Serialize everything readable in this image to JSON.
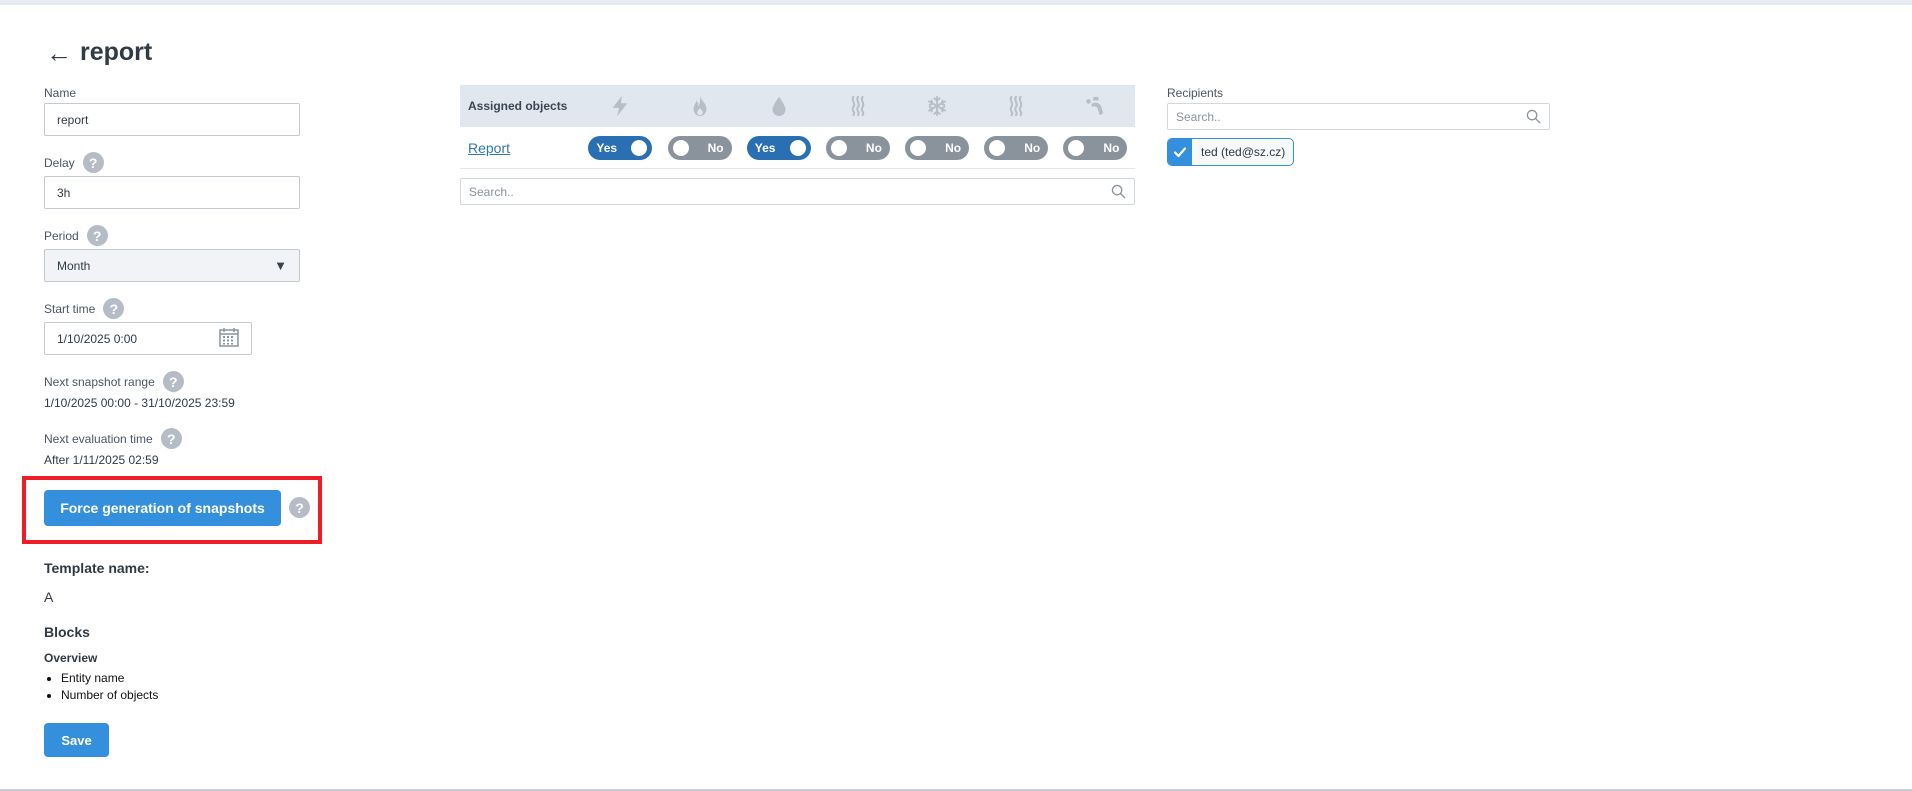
{
  "page": {
    "title": "report"
  },
  "form": {
    "name_label": "Name",
    "name_value": "report",
    "delay_label": "Delay",
    "delay_value": "3h",
    "period_label": "Period",
    "period_value": "Month",
    "start_time_label": "Start time",
    "start_time_value": "1/10/2025 0:00",
    "next_snapshot_label": "Next snapshot range",
    "next_snapshot_value": "1/10/2025 00:00 - 31/10/2025 23:59",
    "next_eval_label": "Next evaluation time",
    "next_eval_value": "After 1/11/2025 02:59",
    "force_button": "Force generation of snapshots",
    "help_glyph": "?"
  },
  "template": {
    "heading": "Template name:",
    "value": "A",
    "blocks_heading": "Blocks",
    "overview_label": "Overview",
    "items": [
      "Entity name",
      "Number of objects"
    ],
    "save_button": "Save"
  },
  "objects": {
    "header_label": "Assigned objects",
    "icons": [
      "lightning-icon",
      "flame-icon",
      "droplet-icon",
      "heat-waves-icon",
      "snowflake-icon",
      "heat-waves-icon",
      "gas-meter-icon"
    ],
    "row_label": "Report",
    "toggles": [
      {
        "label": "Yes",
        "on": true
      },
      {
        "label": "No",
        "on": false
      },
      {
        "label": "Yes",
        "on": true
      },
      {
        "label": "No",
        "on": false
      },
      {
        "label": "No",
        "on": false
      },
      {
        "label": "No",
        "on": false
      },
      {
        "label": "No",
        "on": false
      }
    ],
    "search_placeholder": "Search.."
  },
  "recipients": {
    "label": "Recipients",
    "search_placeholder": "Search..",
    "selected": "ted (ted@sz.cz)"
  },
  "colors": {
    "accent": "#3490dc",
    "toggle_on": "#2a6fb2",
    "toggle_off": "#8a939c",
    "highlight": "#ee1c24",
    "icon_gray": "#b7bec7"
  }
}
